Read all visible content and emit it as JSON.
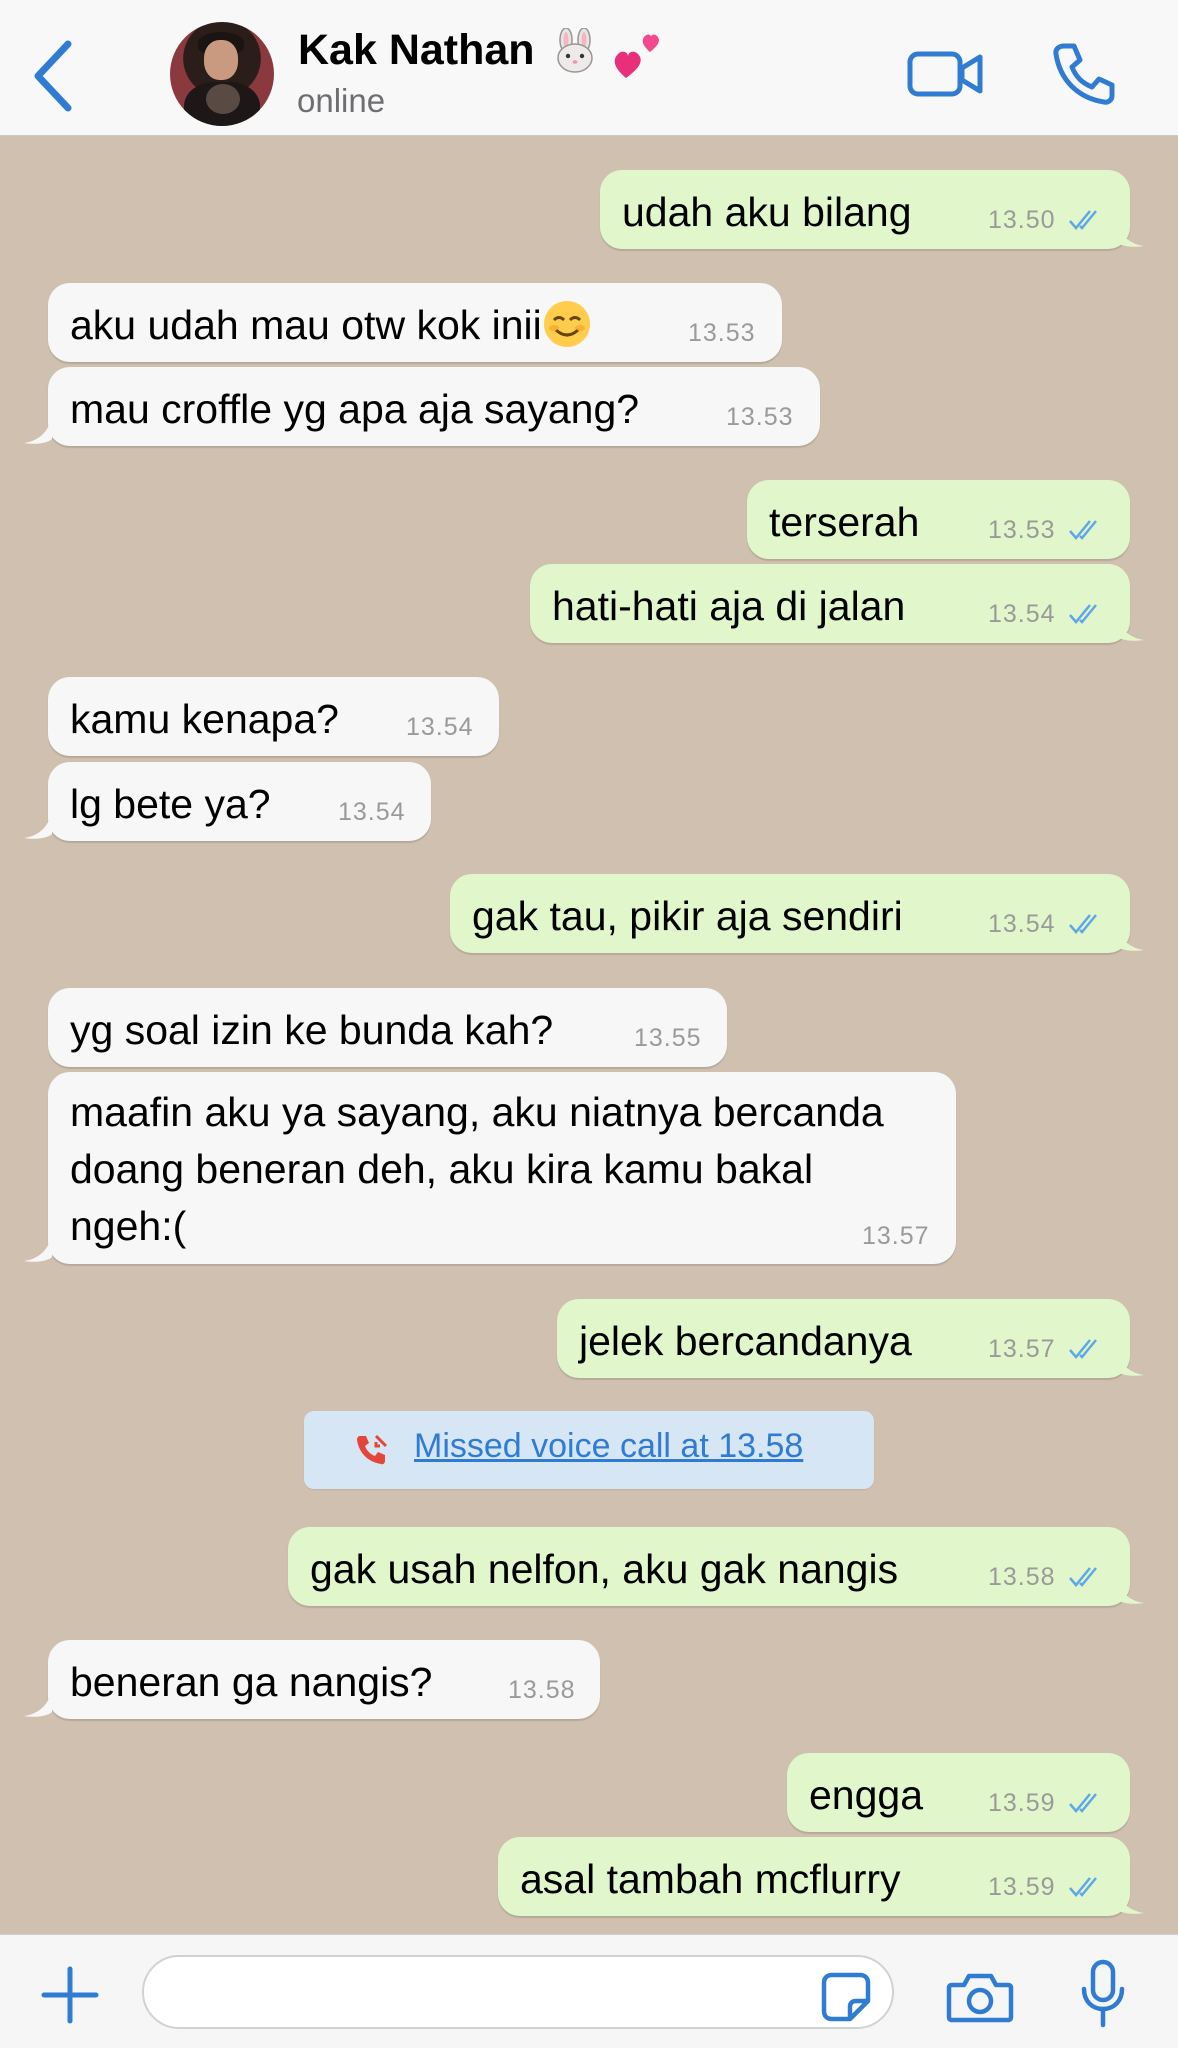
{
  "header": {
    "contact_name": "Kak Nathan",
    "status": "online",
    "icons": [
      "back-chevron-icon",
      "avatar",
      "rabbit-face-emoji",
      "two-hearts-emoji",
      "video-call-icon",
      "phone-call-icon"
    ]
  },
  "colors": {
    "accent": "#2F7CD2",
    "incoming_bubble": "#F7F7F8",
    "outgoing_bubble": "#E2F6CB",
    "chat_background": "#D0C0AF",
    "read_ticks": "#5FA8E8",
    "missed_call_red": "#E5463A"
  },
  "messages": [
    {
      "dir": "out",
      "text": "udah aku bilang",
      "time": "13.50"
    },
    {
      "dir": "in",
      "text": "aku udah mau otw kok inii",
      "time": "13.53"
    },
    {
      "dir": "in",
      "text": "mau croffle yg apa aja sayang?",
      "time": "13.53"
    },
    {
      "dir": "out",
      "text": "terserah",
      "time": "13.53"
    },
    {
      "dir": "out",
      "text": "hati-hati aja di jalan",
      "time": "13.54"
    },
    {
      "dir": "in",
      "text": "kamu kenapa?",
      "time": "13.54"
    },
    {
      "dir": "in",
      "text": "lg bete ya?",
      "time": "13.54"
    },
    {
      "dir": "out",
      "text": "gak tau, pikir aja sendiri",
      "time": "13.54"
    },
    {
      "dir": "in",
      "text": "yg soal izin ke bunda kah?",
      "time": "13.55"
    },
    {
      "dir": "in",
      "lines": [
        "maafin aku ya sayang, aku niatnya bercanda",
        "doang beneran deh, aku kira kamu bakal",
        "ngeh:("
      ],
      "time": "13.57"
    },
    {
      "dir": "out",
      "text": "jelek bercandanya",
      "time": "13.57"
    },
    {
      "dir": "out",
      "text": "gak usah nelfon, aku gak nangis",
      "time": "13.58"
    },
    {
      "dir": "in",
      "text": "beneran ga nangis?",
      "time": "13.58"
    },
    {
      "dir": "out",
      "text": "engga",
      "time": "13.59"
    },
    {
      "dir": "out",
      "text": "asal tambah mcflurry",
      "time": "13.59"
    }
  ],
  "system": {
    "missed_call": "Missed voice call at 13.58"
  },
  "input_bar": {
    "placeholder": "",
    "icons": [
      "plus-icon",
      "sticker-icon",
      "camera-icon",
      "microphone-icon"
    ]
  }
}
